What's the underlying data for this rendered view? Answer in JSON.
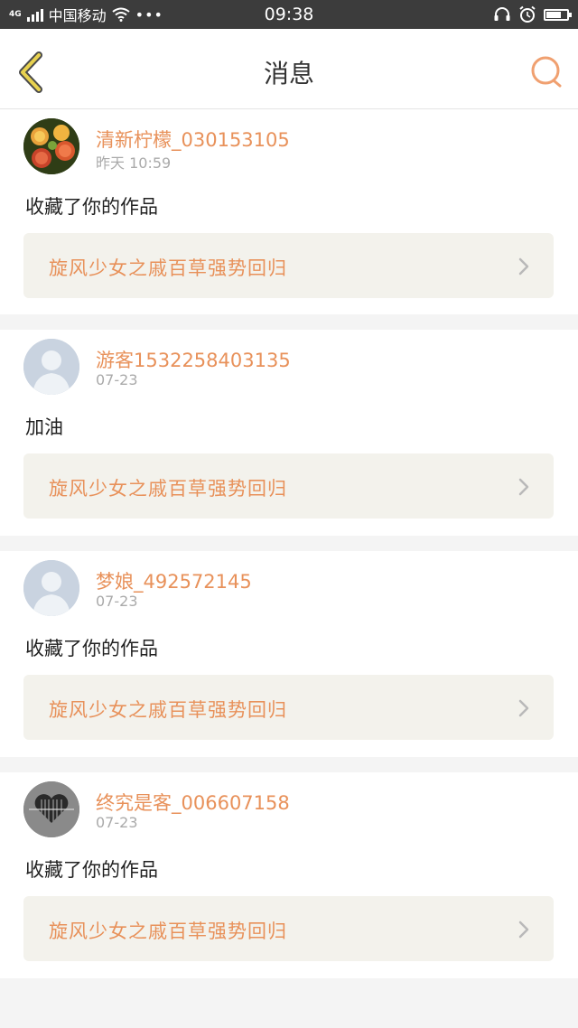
{
  "status_bar": {
    "network": "4G",
    "carrier": "中国移动",
    "more": "•••",
    "time": "09:38",
    "battery_level": 0.65
  },
  "header": {
    "title": "消息",
    "back_icon": "chevron-left-icon",
    "search_icon": "search-icon"
  },
  "colors": {
    "accent": "#e8915a",
    "back": "#e8d250",
    "link_bg": "#f3f2ec"
  },
  "messages": [
    {
      "username": "清新柠檬_030153105",
      "time": "昨天 10:59",
      "content": "收藏了你的作品",
      "work_title": "旋风少女之戚百草强势回归",
      "avatar": "fruit-avatar"
    },
    {
      "username": "游客1532258403135",
      "time": "07-23",
      "content": "加油",
      "work_title": "旋风少女之戚百草强势回归",
      "avatar": "default-avatar"
    },
    {
      "username": "梦娘_492572145",
      "time": "07-23",
      "content": "收藏了你的作品",
      "work_title": "旋风少女之戚百草强势回归",
      "avatar": "default-avatar"
    },
    {
      "username": "终究是客_006607158",
      "time": "07-23",
      "content": "收藏了你的作品",
      "work_title": "旋风少女之戚百草强势回归",
      "avatar": "barcode-heart-avatar"
    }
  ]
}
